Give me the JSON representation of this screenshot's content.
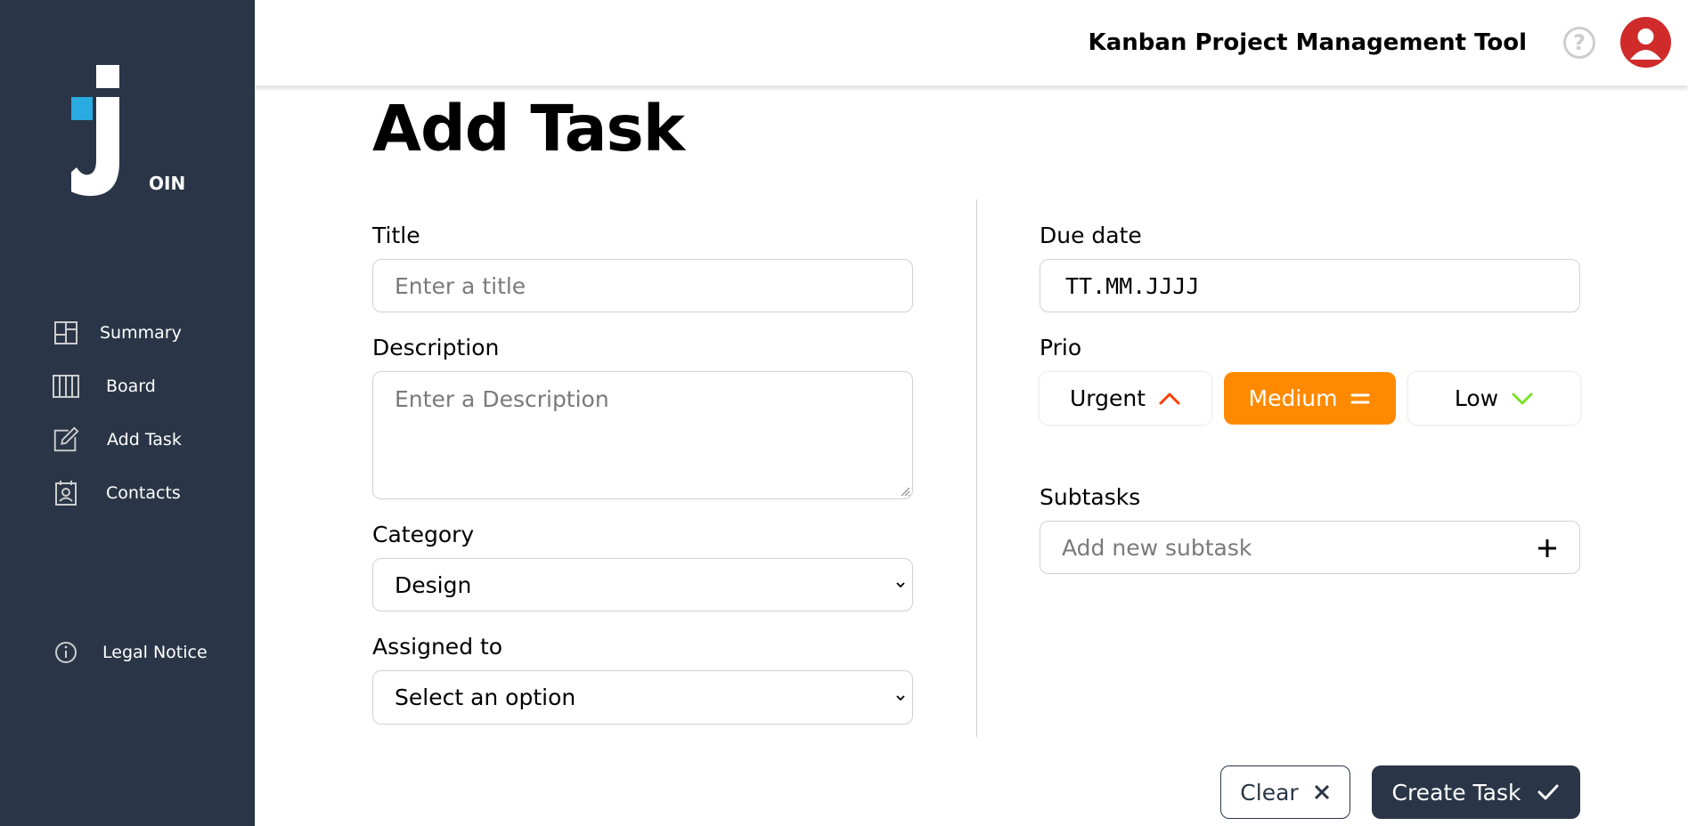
{
  "header": {
    "title": "Kanban Project Management Tool",
    "help_icon": "question-mark-icon",
    "avatar_icon": "user-icon",
    "avatar_color": "#d02b2b"
  },
  "logo": {
    "text": "OIN",
    "accent_color": "#29abe2"
  },
  "sidebar": {
    "background": "#2a3647",
    "items": [
      {
        "label": "Summary",
        "icon": "summary-icon"
      },
      {
        "label": "Board",
        "icon": "board-icon"
      },
      {
        "label": "Add Task",
        "icon": "add-task-icon"
      },
      {
        "label": "Contacts",
        "icon": "contacts-icon"
      }
    ],
    "legal": {
      "label": "Legal Notice",
      "icon": "info-icon"
    }
  },
  "main": {
    "page_title": "Add Task",
    "title_field": {
      "label": "Title",
      "placeholder": "Enter a title"
    },
    "description_field": {
      "label": "Description",
      "placeholder": "Enter a Description"
    },
    "category_field": {
      "label": "Category",
      "value": "Design"
    },
    "assigned_field": {
      "label": "Assigned to",
      "value": "Select an option"
    },
    "due_date_field": {
      "label": "Due date",
      "value": "TT.MM.JJJJ"
    },
    "prio": {
      "label": "Prio",
      "options": [
        {
          "label": "Urgent",
          "icon": "chevron-up-icon",
          "color": "#ff3d00"
        },
        {
          "label": "Medium",
          "icon": "equals-icon",
          "color": "#ffffff",
          "active_bg": "#ff8a00"
        },
        {
          "label": "Low",
          "icon": "chevron-down-icon",
          "color": "#7ae229"
        }
      ],
      "selected": "Medium"
    },
    "subtasks_field": {
      "label": "Subtasks",
      "placeholder": "Add new subtask",
      "icon": "plus-icon"
    }
  },
  "actions": {
    "clear_label": "Clear",
    "clear_icon": "close-icon",
    "create_label": "Create Task",
    "create_icon": "check-icon"
  }
}
